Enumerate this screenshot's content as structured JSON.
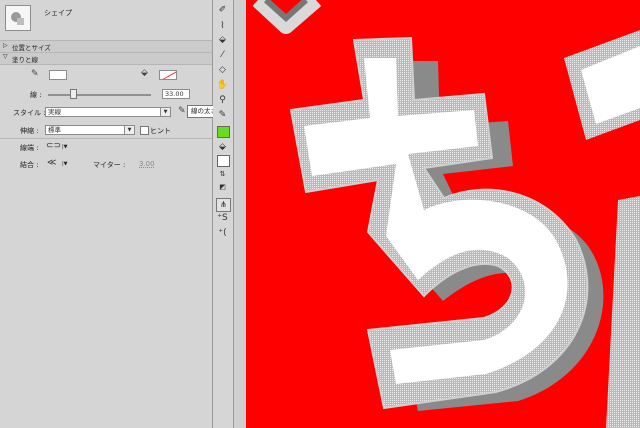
{
  "panel": {
    "title": "シェイプ",
    "sections": {
      "position_size": "位置とサイズ",
      "fill_stroke": "塗りと線"
    },
    "stroke_label": "線 :",
    "stroke_value": "33.00",
    "stroke_slider_fraction": 0.3,
    "style_label": "スタイル :",
    "style_value": "実線",
    "tooltip": "線の太さ",
    "scale_label": "伸縮 :",
    "scale_value": "標準",
    "hint_label": "ヒント",
    "cap_label": "線端 :",
    "join_label": "結合 :",
    "miter_label": "マイター :",
    "miter_value": "3.00"
  },
  "canvas": {
    "glyph_text": "ちび",
    "background_color": "#ff0000"
  },
  "colors": {
    "fill_swatch_color": "#66dd22"
  },
  "icons": {
    "stroke_color": "pencil-icon",
    "fill_color": "paint-bucket-icon",
    "edit_style": "pencil-icon"
  }
}
